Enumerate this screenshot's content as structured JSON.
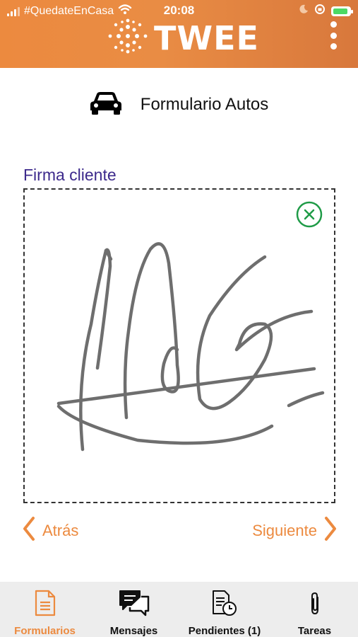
{
  "status_bar": {
    "carrier": "#QuedateEnCasa",
    "time": "20:08",
    "signal_icon": "signal-icon",
    "wifi_icon": "wifi-icon",
    "moon_icon": "moon-icon",
    "lock_rotation_icon": "rotation-lock-icon",
    "battery_icon": "battery-charging-icon",
    "battery_level": 0.9,
    "battery_color": "#4cd964"
  },
  "header": {
    "logo_text": "TWEE",
    "menu_icon": "more-vertical-icon",
    "background_color": "#ec8a3f"
  },
  "form": {
    "title": "Formulario Autos",
    "icon": "car-icon"
  },
  "signature": {
    "label": "Firma cliente",
    "label_color": "#3d2a8c",
    "clear_icon": "clear-circle-icon",
    "clear_color": "#1f9b47"
  },
  "navigation": {
    "back_label": "Atrás",
    "next_label": "Siguiente",
    "accent_color": "#ec8a3f"
  },
  "tabbar": {
    "tabs": [
      {
        "label": "Formularios",
        "icon": "document-icon",
        "active": true
      },
      {
        "label": "Mensajes",
        "icon": "chat-icon",
        "active": false
      },
      {
        "label": "Pendientes (1)",
        "icon": "pending-doc-icon",
        "active": false
      },
      {
        "label": "Tareas",
        "icon": "paperclip-icon",
        "active": false
      }
    ]
  }
}
